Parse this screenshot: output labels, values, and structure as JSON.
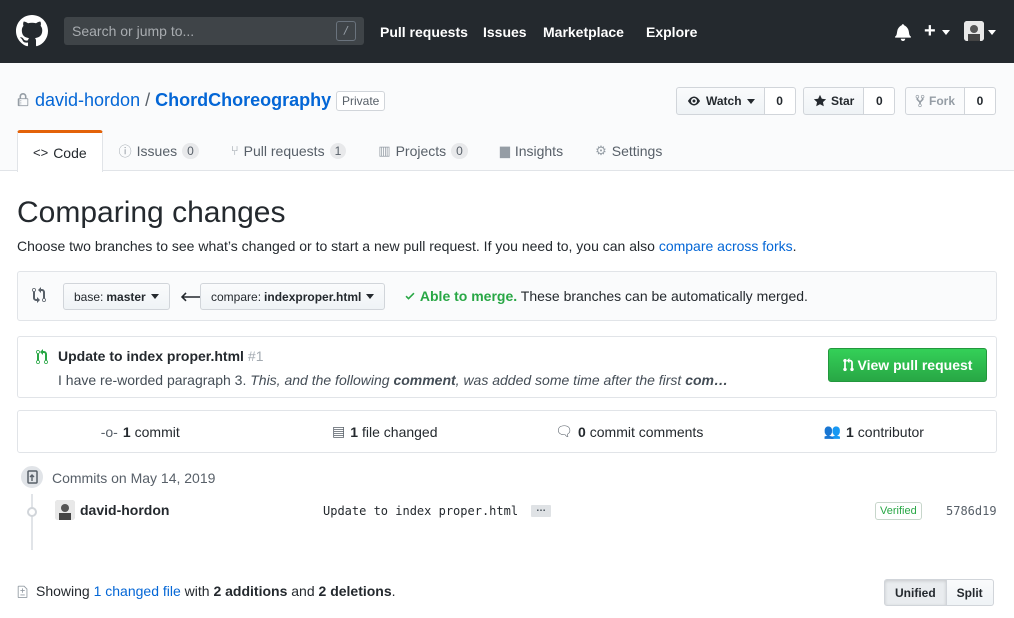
{
  "header": {
    "search_placeholder": "Search or jump to...",
    "slash_key": "/",
    "nav": [
      "Pull requests",
      "Issues",
      "Marketplace",
      "Explore"
    ],
    "plus_label": "+"
  },
  "repo": {
    "owner": "david-hordon",
    "separator": "/",
    "name": "ChordChoreography",
    "visibility": "Private",
    "watch_label": "Watch",
    "watch_count": "0",
    "star_label": "Star",
    "star_count": "0",
    "fork_label": "Fork",
    "fork_count": "0"
  },
  "tabs": [
    {
      "label": "Code",
      "icon": "code-icon",
      "counter": ""
    },
    {
      "label": "Issues",
      "icon": "issue-icon",
      "counter": "0"
    },
    {
      "label": "Pull requests",
      "icon": "pull-request-icon",
      "counter": "1"
    },
    {
      "label": "Projects",
      "icon": "project-icon",
      "counter": "0"
    },
    {
      "label": "Insights",
      "icon": "graph-icon",
      "counter": ""
    },
    {
      "label": "Settings",
      "icon": "gear-icon",
      "counter": ""
    }
  ],
  "compare": {
    "title": "Comparing changes",
    "subhead_text": "Choose two branches to see what’s changed or to start a new pull request. If you need to, you can also ",
    "subhead_link": "compare across forks",
    "subhead_end": ".",
    "base_prefix": "base:",
    "base_branch": "master",
    "compare_prefix": "compare:",
    "compare_branch": "indexproper.html",
    "merge_ok": "Able to merge.",
    "merge_text": " These branches can be automatically merged."
  },
  "pull_request": {
    "title": "Update to index proper.html",
    "number": "#1",
    "desc_start": "I have re-worded paragraph 3. ",
    "desc_em1": "This, and the following ",
    "desc_bold": "comment",
    "desc_em2": ", was added some time after the first ",
    "desc_bold2": "com…",
    "button_label": "View pull request"
  },
  "summary": [
    {
      "count": "1",
      "label": "commit",
      "icon": "commit-icon"
    },
    {
      "count": "1",
      "label": "file changed",
      "icon": "file-diff-icon"
    },
    {
      "count": "0",
      "label": "commit comments",
      "icon": "comment-icon"
    },
    {
      "count": "1",
      "label": "contributor",
      "icon": "people-icon"
    }
  ],
  "commits": {
    "date_label": "Commits on May 14, 2019",
    "items": [
      {
        "author": "david-hordon",
        "message": "Update to index proper.html",
        "ellipsis": "…",
        "verified": "Verified",
        "sha": "5786d19"
      }
    ]
  },
  "files": {
    "showing": "Showing ",
    "changed_link": "1 changed file",
    "with": " with ",
    "additions": "2 additions",
    "and": " and ",
    "deletions": "2 deletions",
    "end": ".",
    "unified_label": "Unified",
    "split_label": "Split"
  },
  "colors": {
    "header_bg": "#24292e",
    "link": "#0366d6",
    "success": "#28a745",
    "tab_accent": "#e36209"
  }
}
